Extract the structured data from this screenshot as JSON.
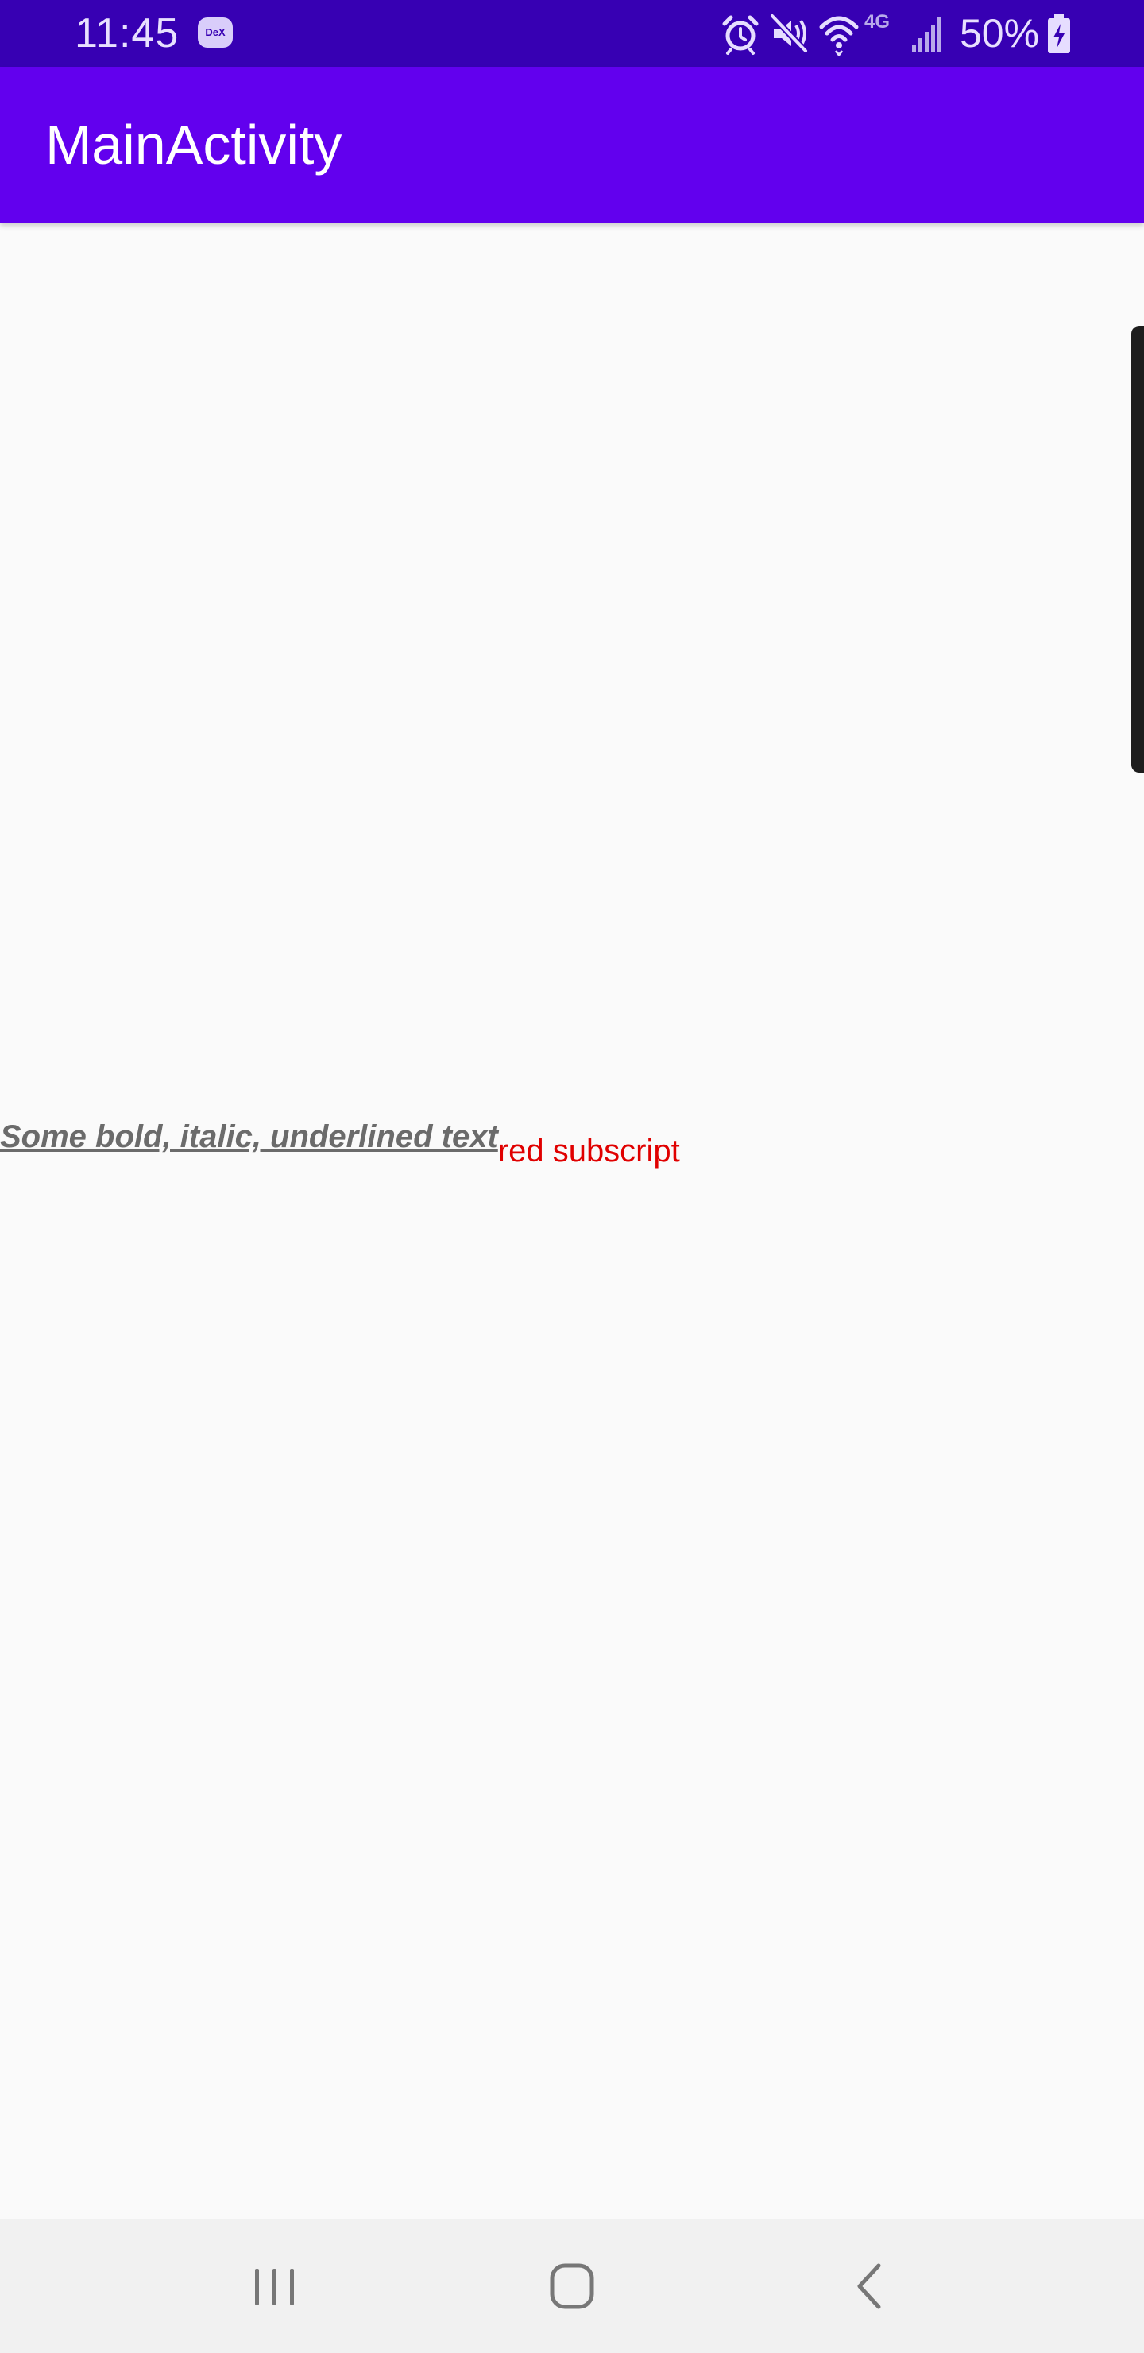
{
  "status_bar": {
    "time": "11:45",
    "dex_label": "DeX",
    "network_label": "4G",
    "battery_percent": "50%",
    "icons": [
      "alarm-icon",
      "mute-icon",
      "wifi-icon",
      "signal-icon",
      "battery-charging-icon"
    ],
    "background": "#3700b3"
  },
  "app_bar": {
    "title": "MainActivity",
    "background": "#6200ee"
  },
  "content": {
    "styled_text": "Some bold, italic, underlined text",
    "red_text": "red subscript",
    "red_color": "#e00000",
    "text_color": "#6b6b6b"
  },
  "nav_bar": {
    "buttons": [
      "recents-icon",
      "home-icon",
      "back-icon"
    ]
  }
}
